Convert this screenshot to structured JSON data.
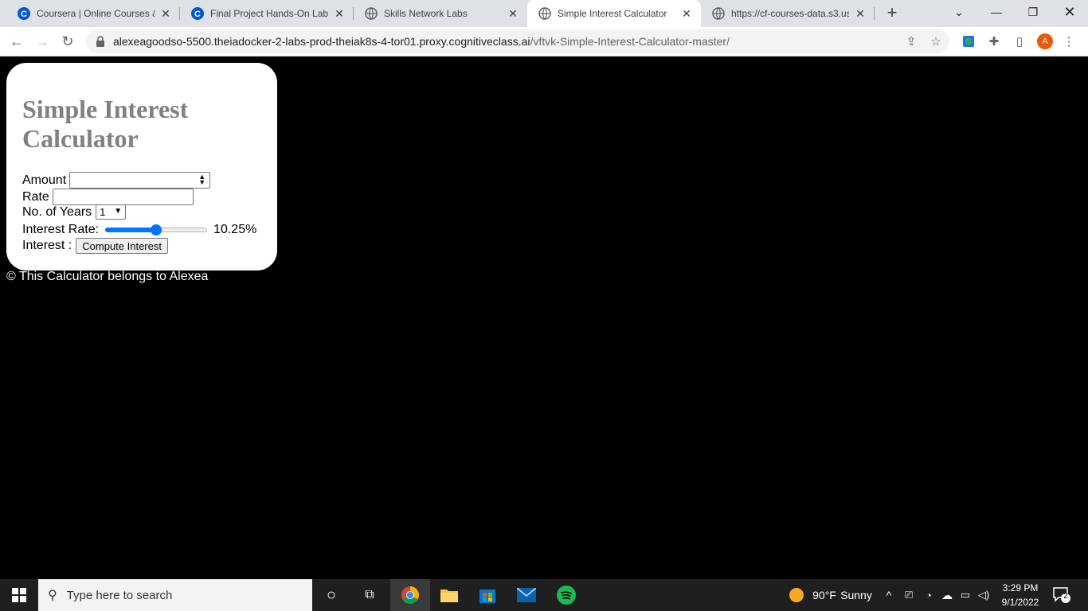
{
  "browser": {
    "tabs": [
      {
        "title": "Coursera | Online Courses & ",
        "favicon": "coursera-icon"
      },
      {
        "title": "Final Project Hands-On Lab | ",
        "favicon": "coursera-icon"
      },
      {
        "title": "Skills Network Labs",
        "favicon": "globe-icon"
      },
      {
        "title": "Simple Interest Calculator",
        "favicon": "globe-icon",
        "active": true
      },
      {
        "title": "https://cf-courses-data.s3.us.",
        "favicon": "globe-icon"
      }
    ],
    "url_host": "alexeagoodso-5500.theiadocker-2-labs-prod-theiak8s-4-tor01.proxy.cognitiveclass.ai",
    "url_path": "/vftvk-Simple-Interest-Calculator-master/",
    "profile_initial": "A"
  },
  "page": {
    "heading": "Simple Interest Calculator",
    "amount_label": "Amount",
    "amount_value": "",
    "rate_label": "Rate",
    "rate_value": "",
    "years_label": "No. of Years",
    "years_selected": "1",
    "interest_rate_label": "Interest Rate:",
    "interest_rate_value": "10.25%",
    "interest_rate_fraction": 0.5,
    "interest_label": "Interest :",
    "compute_button": "Compute Interest",
    "footer": "© This Calculator belongs to Alexea"
  },
  "taskbar": {
    "search_placeholder": "Type here to search",
    "weather_temp": "90°F",
    "weather_desc": "Sunny",
    "time": "3:29 PM",
    "date": "9/1/2022",
    "notifications": "2"
  },
  "colors": {
    "accent": "#0075ff",
    "heading": "#808080"
  }
}
